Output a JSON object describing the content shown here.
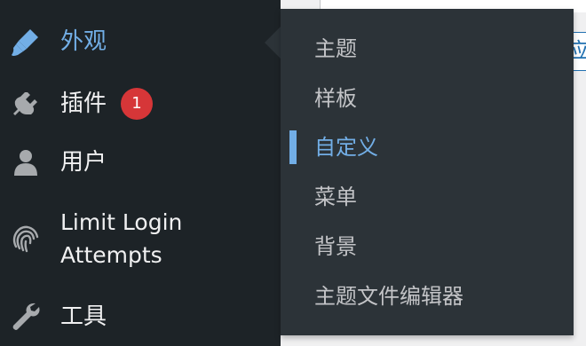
{
  "colors": {
    "sidebar_bg": "#1d2327",
    "submenu_bg": "#2c3338",
    "text": "#f0f0f1",
    "submenu_text": "#c3c4c7",
    "accent": "#72aee6",
    "badge": "#d63638"
  },
  "sidebar": {
    "items": [
      {
        "label": "外观",
        "icon": "paintbrush-icon",
        "current": true
      },
      {
        "label": "插件",
        "icon": "plugin-icon",
        "badge": "1"
      },
      {
        "label": "用户",
        "icon": "user-icon"
      },
      {
        "label_line1": "Limit Login",
        "label_line2": "Attempts",
        "icon": "fingerprint-icon"
      },
      {
        "label": "工具",
        "icon": "wrench-icon"
      }
    ]
  },
  "submenu": {
    "items": [
      {
        "label": "主题"
      },
      {
        "label": "样板"
      },
      {
        "label": "自定义",
        "active": true
      },
      {
        "label": "菜单"
      },
      {
        "label": "背景"
      },
      {
        "label": "主题文件编辑器"
      }
    ]
  },
  "background": {
    "field_text": "应用"
  }
}
